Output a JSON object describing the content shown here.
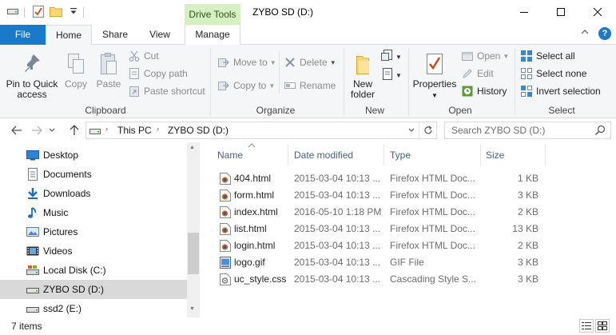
{
  "titlebar": {
    "context_tab": "Drive Tools",
    "title": "ZYBO SD (D:)",
    "quick_access": [
      "drive-icon",
      "properties-check-icon",
      "new-folder-icon",
      "customize-dropdown-icon"
    ]
  },
  "tabs": {
    "file": "File",
    "home": "Home",
    "share": "Share",
    "view": "View",
    "manage": "Manage"
  },
  "ribbon": {
    "clipboard": {
      "label": "Clipboard",
      "pin": "Pin to Quick access",
      "copy": "Copy",
      "paste": "Paste",
      "cut": "Cut",
      "copy_path": "Copy path",
      "paste_shortcut": "Paste shortcut"
    },
    "organize": {
      "label": "Organize",
      "move_to": "Move to",
      "copy_to": "Copy to",
      "delete": "Delete",
      "rename": "Rename"
    },
    "new": {
      "label": "New",
      "new_folder": "New folder"
    },
    "open": {
      "label": "Open",
      "properties": "Properties",
      "open": "Open",
      "edit": "Edit",
      "history": "History"
    },
    "select": {
      "label": "Select",
      "select_all": "Select all",
      "select_none": "Select none",
      "invert": "Invert selection"
    }
  },
  "address": {
    "crumbs": [
      "This PC",
      "ZYBO SD (D:)"
    ],
    "search_placeholder": "Search ZYBO SD (D:)"
  },
  "nav": {
    "items": [
      {
        "label": "Desktop",
        "icon": "desktop-icon"
      },
      {
        "label": "Documents",
        "icon": "documents-icon"
      },
      {
        "label": "Downloads",
        "icon": "downloads-icon"
      },
      {
        "label": "Music",
        "icon": "music-icon"
      },
      {
        "label": "Pictures",
        "icon": "pictures-icon"
      },
      {
        "label": "Videos",
        "icon": "videos-icon"
      },
      {
        "label": "Local Disk (C:)",
        "icon": "local-disk-icon"
      },
      {
        "label": "ZYBO SD (D:)",
        "icon": "sd-drive-icon",
        "selected": true
      },
      {
        "label": "ssd2 (E:)",
        "icon": "drive-icon"
      }
    ]
  },
  "files": {
    "columns": {
      "name": "Name",
      "date": "Date modified",
      "type": "Type",
      "size": "Size"
    },
    "rows": [
      {
        "name": "404.html",
        "date": "2015-03-04 10:13 ...",
        "type": "Firefox HTML Doc...",
        "size": "1 KB",
        "icon": "html-file-icon"
      },
      {
        "name": "form.html",
        "date": "2015-03-04 10:13 ...",
        "type": "Firefox HTML Doc...",
        "size": "3 KB",
        "icon": "html-file-icon"
      },
      {
        "name": "index.html",
        "date": "2016-05-10 1:18 PM",
        "type": "Firefox HTML Doc...",
        "size": "2 KB",
        "icon": "html-file-icon"
      },
      {
        "name": "list.html",
        "date": "2015-03-04 10:13 ...",
        "type": "Firefox HTML Doc...",
        "size": "13 KB",
        "icon": "html-file-icon"
      },
      {
        "name": "login.html",
        "date": "2015-03-04 10:13 ...",
        "type": "Firefox HTML Doc...",
        "size": "2 KB",
        "icon": "html-file-icon"
      },
      {
        "name": "logo.gif",
        "date": "2015-03-04 10:13 ...",
        "type": "GIF File",
        "size": "3 KB",
        "icon": "gif-file-icon"
      },
      {
        "name": "uc_style.css",
        "date": "2015-03-04 10:13 ...",
        "type": "Cascading Style S...",
        "size": "3 KB",
        "icon": "css-file-icon"
      }
    ]
  },
  "status": {
    "text": "7 items"
  },
  "colors": {
    "accent": "#1979ca",
    "context_tab": "#d7f0c2",
    "selection": "#d9d9d9"
  }
}
